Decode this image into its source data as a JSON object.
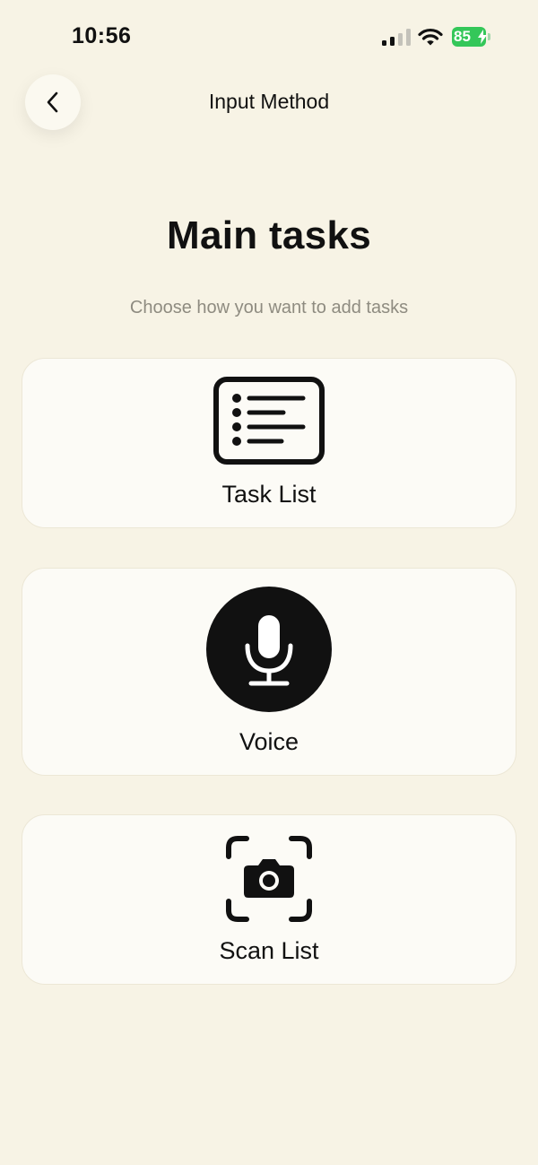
{
  "status_bar": {
    "time": "10:56",
    "battery_level": "85",
    "battery_color": "#34c759"
  },
  "nav": {
    "back_icon": "chevron-left-icon",
    "title": "Input Method"
  },
  "main": {
    "title": "Main tasks",
    "subtitle": "Choose how you want to add tasks"
  },
  "options": [
    {
      "label": "Task List",
      "icon": "list-icon"
    },
    {
      "label": "Voice",
      "icon": "microphone-icon"
    },
    {
      "label": "Scan List",
      "icon": "camera-scan-icon"
    }
  ],
  "colors": {
    "background": "#f7f3e5",
    "card": "#fcfbf6",
    "text": "#111111",
    "subtitle": "#8e8b80"
  }
}
